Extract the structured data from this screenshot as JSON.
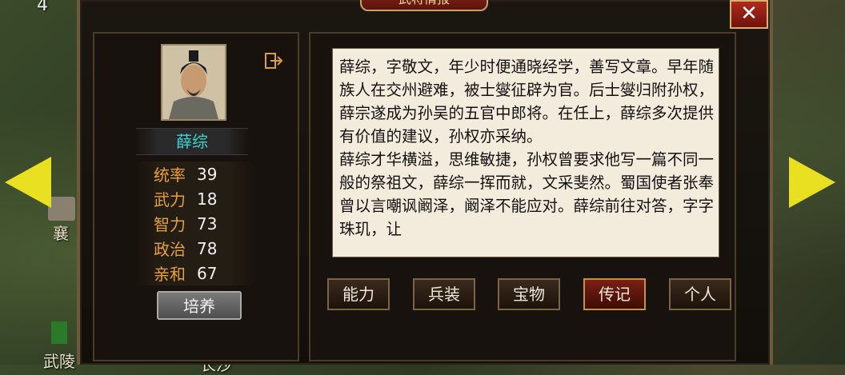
{
  "map": {
    "number": "4",
    "labels": [
      "襄",
      "武陵",
      "长沙"
    ]
  },
  "header": {
    "title": "武将情报",
    "close_label": "✕"
  },
  "general": {
    "name": "薛综",
    "exit_icon": "exit-icon",
    "stats": [
      {
        "label": "统率",
        "value": "39"
      },
      {
        "label": "武力",
        "value": "18"
      },
      {
        "label": "智力",
        "value": "73"
      },
      {
        "label": "政治",
        "value": "78"
      },
      {
        "label": "亲和",
        "value": "67"
      }
    ],
    "train_label": "培养"
  },
  "bio": {
    "paragraphs": [
      "薛综，字敬文，年少时便通晓经学，善写文章。早年随族人在交州避难，被士燮征辟为官。后士燮归附孙权，薛宗遂成为孙吴的五官中郎将。在任上，薛综多次提供有价值的建议，孙权亦采纳。",
      "薛综才华横溢，思维敏捷，孙权曾要求他写一篇不同一般的祭祖文，薛综一挥而就，文采斐然。蜀国使者张奉曾以言嘲讽阚泽，阚泽不能应对。薛综前往对答，字字珠玑，让"
    ]
  },
  "tabs": [
    {
      "label": "能力",
      "active": false
    },
    {
      "label": "兵装",
      "active": false
    },
    {
      "label": "宝物",
      "active": false
    },
    {
      "label": "传记",
      "active": true
    },
    {
      "label": "个人",
      "active": false
    }
  ],
  "colors": {
    "accent": "#e8a038",
    "name": "#3ad4d0",
    "active_tab": "#7a2012"
  }
}
